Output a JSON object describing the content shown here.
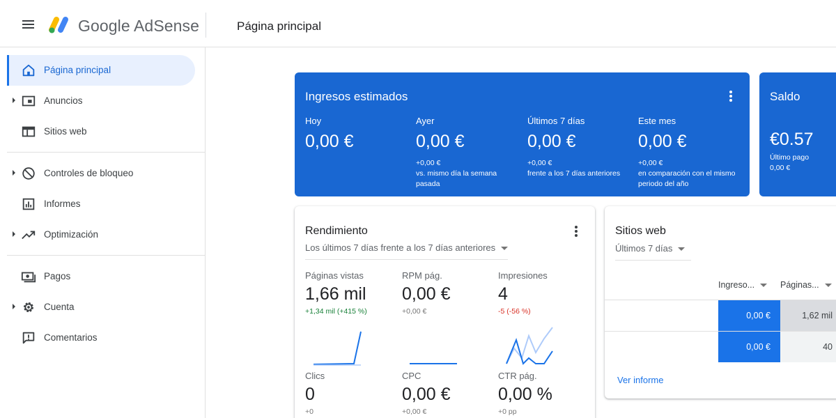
{
  "header": {
    "brand": "Google AdSense",
    "page_title": "Página principal"
  },
  "sidebar": {
    "items": [
      {
        "label": "Página principal",
        "icon": "home-icon"
      },
      {
        "label": "Anuncios",
        "icon": "ads-icon"
      },
      {
        "label": "Sitios web",
        "icon": "web-icon"
      },
      {
        "label": "Controles de bloqueo",
        "icon": "block-icon"
      },
      {
        "label": "Informes",
        "icon": "bar-chart-icon"
      },
      {
        "label": "Optimización",
        "icon": "trending-up-icon"
      },
      {
        "label": "Pagos",
        "icon": "payments-icon"
      },
      {
        "label": "Cuenta",
        "icon": "gear-icon"
      },
      {
        "label": "Comentarios",
        "icon": "feedback-icon"
      }
    ]
  },
  "earnings": {
    "title": "Ingresos estimados",
    "columns": [
      {
        "label": "Hoy",
        "value": "0,00 €",
        "delta": "",
        "note": ""
      },
      {
        "label": "Ayer",
        "value": "0,00 €",
        "delta": "+0,00 €",
        "note": "vs. mismo día la semana pasada"
      },
      {
        "label": "Últimos 7 días",
        "value": "0,00 €",
        "delta": "+0,00 €",
        "note": "frente a los 7 días anteriores"
      },
      {
        "label": "Este mes",
        "value": "0,00 €",
        "delta": "+0,00 €",
        "note": "en comparación con el mismo periodo del año"
      }
    ]
  },
  "balance": {
    "title": "Saldo",
    "value": "€0.57",
    "last_payment_label": "Último pago",
    "last_payment_value": "0,00 €"
  },
  "performance": {
    "title": "Rendimiento",
    "period": "Los últimos 7 días frente a los 7 días anteriores",
    "metrics": [
      {
        "label": "Páginas vistas",
        "value": "1,66 mil",
        "change": "+1,34 mil (+415 %)",
        "trend": "up"
      },
      {
        "label": "RPM pág.",
        "value": "0,00 €",
        "change": "+0,00 €",
        "trend": "neutral"
      },
      {
        "label": "Impresiones",
        "value": "4",
        "change": "-5 (-56 %)",
        "trend": "down"
      },
      {
        "label": "Clics",
        "value": "0",
        "change": "+0",
        "trend": "neutral"
      },
      {
        "label": "CPC",
        "value": "0,00 €",
        "change": "+0,00 €",
        "trend": "neutral"
      },
      {
        "label": "CTR pág.",
        "value": "0,00 %",
        "change": "+0 pp",
        "trend": "neutral"
      }
    ]
  },
  "sites": {
    "title": "Sitios web",
    "period": "Últimos 7 días",
    "columns": [
      "Ingreso...",
      "Páginas..."
    ],
    "rows": [
      {
        "earnings": "0,00 €",
        "pages": "1,62 mil"
      },
      {
        "earnings": "0,00 €",
        "pages": "40"
      }
    ],
    "see_report": "Ver informe"
  },
  "colors": {
    "accent_blue": "#1967d2",
    "link_blue": "#1a73e8",
    "positive": "#188038",
    "negative": "#d93025"
  }
}
